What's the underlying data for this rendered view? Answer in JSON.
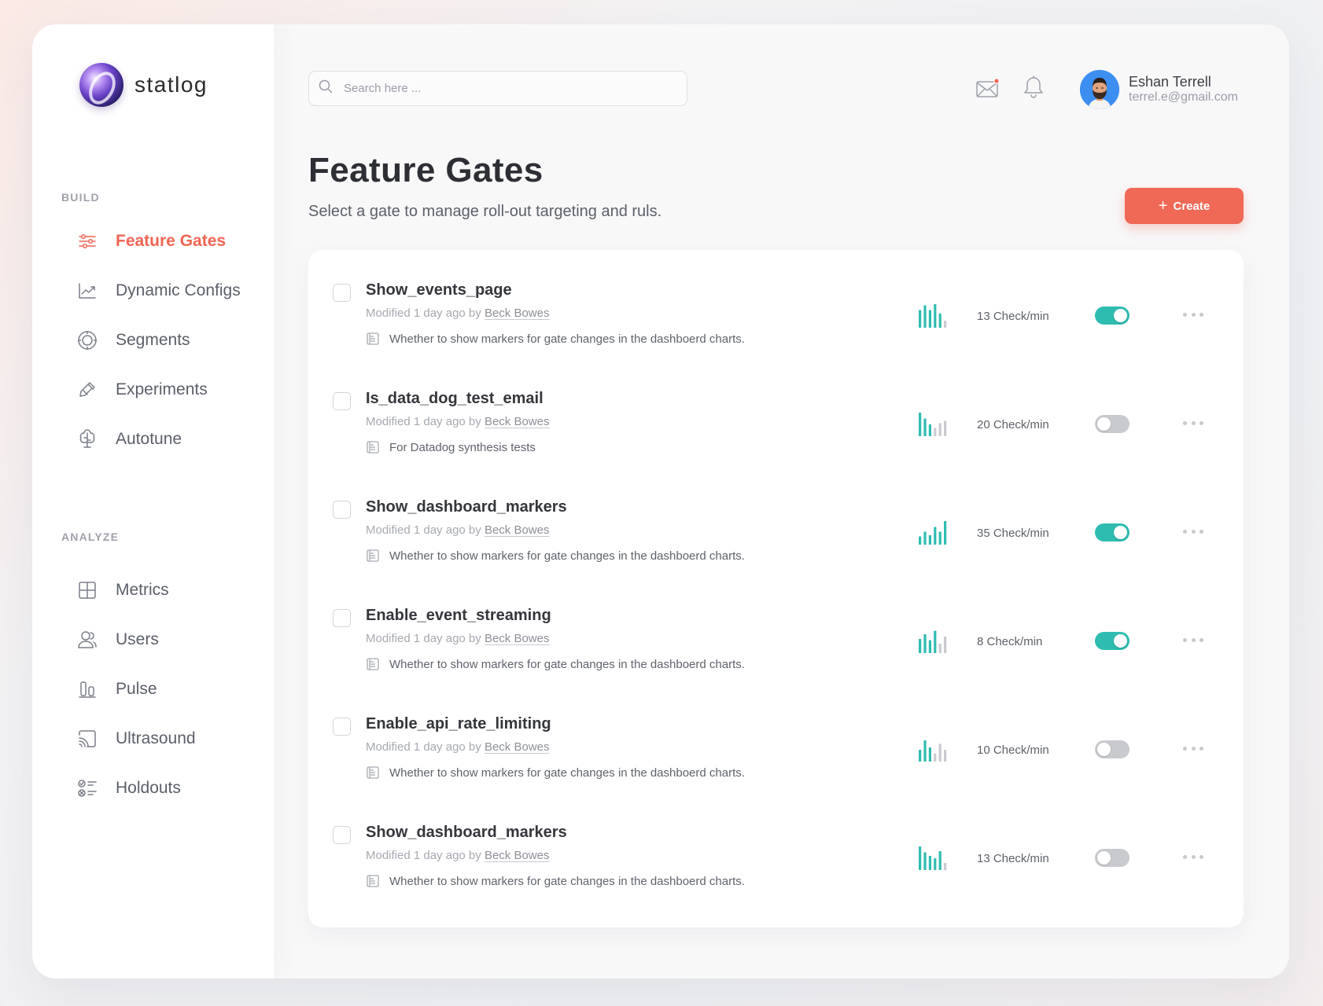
{
  "brand": {
    "name": "statlog"
  },
  "sidebar": {
    "sections": [
      {
        "label": "BUILD",
        "items": [
          {
            "label": "Feature Gates",
            "icon": "sliders-icon",
            "active": true
          },
          {
            "label": "Dynamic Configs",
            "icon": "trend-chart-icon",
            "active": false
          },
          {
            "label": "Segments",
            "icon": "target-icon",
            "active": false
          },
          {
            "label": "Experiments",
            "icon": "pipette-icon",
            "active": false
          },
          {
            "label": "Autotune",
            "icon": "brain-icon",
            "active": false
          }
        ]
      },
      {
        "label": "ANALYZE",
        "items": [
          {
            "label": "Metrics",
            "icon": "grid-icon",
            "active": false
          },
          {
            "label": "Users",
            "icon": "users-icon",
            "active": false
          },
          {
            "label": "Pulse",
            "icon": "pulse-bars-icon",
            "active": false
          },
          {
            "label": "Ultrasound",
            "icon": "cast-icon",
            "active": false
          },
          {
            "label": "Holdouts",
            "icon": "checklist-icon",
            "active": false
          }
        ]
      }
    ]
  },
  "header": {
    "search_placeholder": "Search here ...",
    "user": {
      "name": "Eshan Terrell",
      "email": "terrel.e@gmail.com"
    },
    "mail_has_unread": true
  },
  "page": {
    "title": "Feature Gates",
    "subtitle": "Select a gate to manage roll-out targeting and ruls.",
    "create_label": "Create"
  },
  "colors": {
    "accent": "#f06856",
    "toggle_on": "#2ebcb1",
    "toggle_off": "#c8cace",
    "spark": "#2ebcb1",
    "spark_muted": "#c9cbd0"
  },
  "gates": [
    {
      "name": "Show_events_page",
      "modified": "Modified 1 day ago by ",
      "author": "Beck Bowes",
      "description": "Whether to show markers for gate changes in the dashboerd charts.",
      "rate": "13 Check/min",
      "enabled": true,
      "spark": [
        0.75,
        0.95,
        0.75,
        1.0,
        0.6,
        0.3
      ],
      "spark_active": 5
    },
    {
      "name": "Is_data_dog_test_email",
      "modified": "Modified 1 day ago by ",
      "author": "Beck Bowes",
      "description": "For Datadog synthesis tests",
      "rate": "20 Check/min",
      "enabled": false,
      "spark": [
        1.0,
        0.75,
        0.5,
        0.35,
        0.55,
        0.65
      ],
      "spark_active": 3
    },
    {
      "name": "Show_dashboard_markers",
      "modified": "Modified 1 day ago by ",
      "author": "Beck Bowes",
      "description": "Whether to show markers for gate changes in the dashboerd charts.",
      "rate": "35 Check/min",
      "enabled": true,
      "spark": [
        0.35,
        0.55,
        0.4,
        0.75,
        0.55,
        1.0
      ],
      "spark_active": 6
    },
    {
      "name": "Enable_event_streaming",
      "modified": "Modified 1 day ago by ",
      "author": "Beck Bowes",
      "description": "Whether to show markers for gate changes in the dashboerd charts.",
      "rate": "8 Check/min",
      "enabled": true,
      "spark": [
        0.6,
        0.8,
        0.55,
        0.95,
        0.4,
        0.7
      ],
      "spark_active": 4
    },
    {
      "name": "Enable_api_rate_limiting",
      "modified": "Modified 1 day ago by ",
      "author": "Beck Bowes",
      "description": "Whether to show markers for gate changes in the dashboerd charts.",
      "rate": "10 Check/min",
      "enabled": false,
      "spark": [
        0.5,
        0.9,
        0.6,
        0.35,
        0.75,
        0.5
      ],
      "spark_active": 3
    },
    {
      "name": "Show_dashboard_markers",
      "modified": "Modified 1 day ago by ",
      "author": "Beck Bowes",
      "description": "Whether to show markers for gate changes in the dashboerd charts.",
      "rate": "13 Check/min",
      "enabled": false,
      "spark": [
        1.0,
        0.75,
        0.6,
        0.5,
        0.8,
        0.3
      ],
      "spark_active": 5
    }
  ]
}
